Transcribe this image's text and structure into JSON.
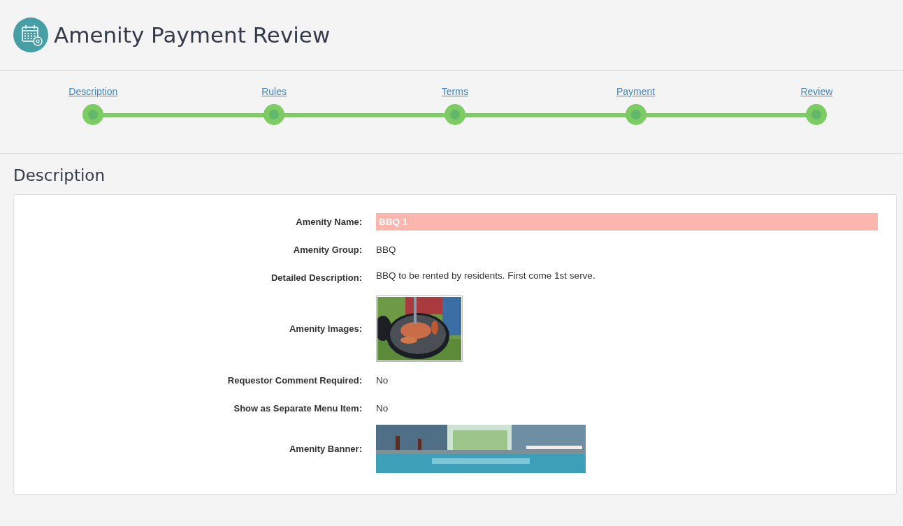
{
  "page": {
    "title": "Amenity Payment Review"
  },
  "steps": [
    {
      "label": "Description"
    },
    {
      "label": "Rules"
    },
    {
      "label": "Terms"
    },
    {
      "label": "Payment"
    },
    {
      "label": "Review"
    }
  ],
  "section": {
    "title": "Description"
  },
  "fields": [
    {
      "kind": "highlight",
      "label": "Amenity Name:",
      "value": "BBQ 1"
    },
    {
      "kind": "text",
      "label": "Amenity Group:",
      "value": "BBQ"
    },
    {
      "kind": "text",
      "label": "Detailed Description:",
      "value": "BBQ to be rented by residents. First come 1st serve."
    },
    {
      "label": "Amenity Images:"
    },
    {
      "kind": "text",
      "label": "Requestor Comment Required:",
      "value": "No"
    },
    {
      "kind": "text",
      "label": "Show as Separate Menu Item:",
      "value": "No"
    },
    {
      "kind": "banner",
      "label": "Amenity Banner:"
    }
  ]
}
